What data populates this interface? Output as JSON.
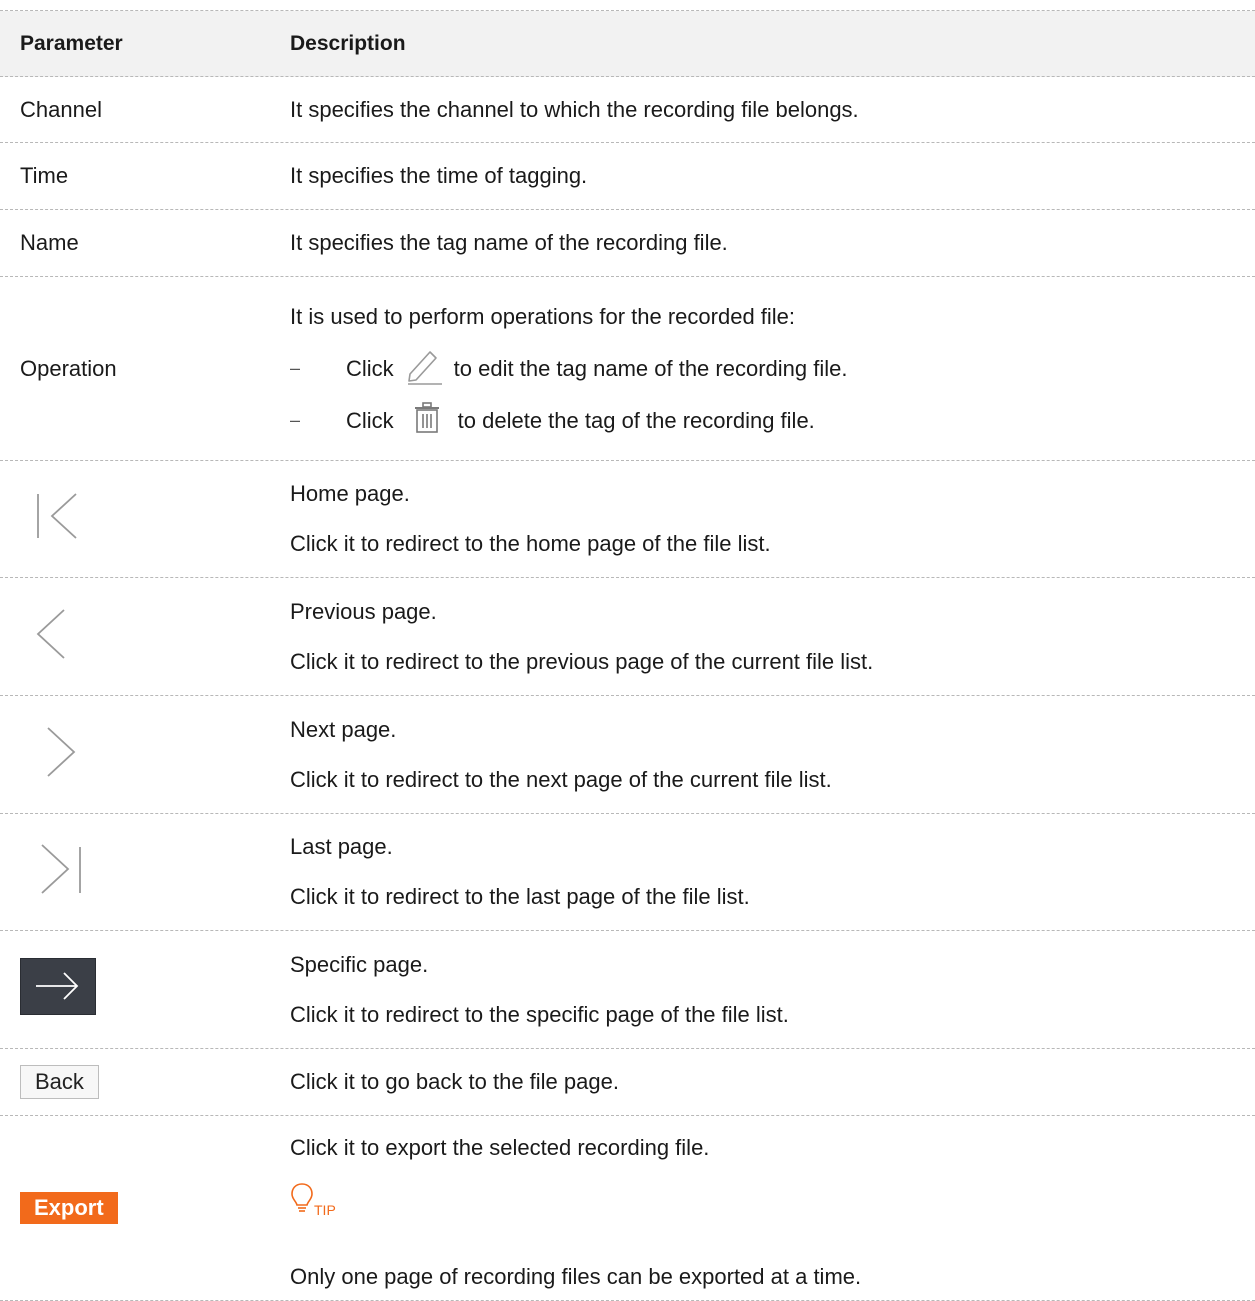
{
  "header": {
    "parameter": "Parameter",
    "description": "Description"
  },
  "rows": {
    "channel": {
      "param": "Channel",
      "desc": "It specifies the channel to which the recording file belongs."
    },
    "time": {
      "param": "Time",
      "desc": "It specifies the time of tagging."
    },
    "name": {
      "param": "Name",
      "desc": "It specifies the tag name of the recording file."
    },
    "operation": {
      "param": "Operation",
      "intro": "It is used to perform operations for the recorded file:",
      "bullet_mark": "–",
      "edit_prefix": "Click",
      "edit_suffix": "to edit the tag name of the recording file.",
      "delete_prefix": "Click",
      "delete_suffix": "to delete the tag of the recording file.",
      "edit_icon": "edit-pencil-icon",
      "delete_icon": "trash-icon"
    },
    "home": {
      "icon": "first-page-icon",
      "title": "Home page.",
      "desc": "Click it to redirect to the home page of the file list."
    },
    "previous": {
      "icon": "chevron-left-icon",
      "title": "Previous page.",
      "desc": "Click it to redirect to the previous page of the current file list."
    },
    "next": {
      "icon": "chevron-right-icon",
      "title": "Next page.",
      "desc": "Click it to redirect to the next page of the current file list."
    },
    "last": {
      "icon": "last-page-icon",
      "title": "Last page.",
      "desc": "Click it to redirect to the last page of the file list."
    },
    "specific": {
      "icon": "arrow-right-icon",
      "title": "Specific page.",
      "desc": "Click it to redirect to the specific page of the file list."
    },
    "back": {
      "button_label": "Back",
      "desc": "Click it to go back to the file page."
    },
    "export": {
      "button_label": "Export",
      "desc": "Click it to export the selected recording file.",
      "tip_label": "TIP",
      "tip_icon": "lightbulb-icon",
      "tip_text": "Only one page of recording files can be exported at a time."
    }
  },
  "colors": {
    "accent": "#f26a1b",
    "header_bg": "#f2f2f2",
    "go_button_bg": "#3b3f47",
    "icon_gray": "#9a9a9a"
  }
}
